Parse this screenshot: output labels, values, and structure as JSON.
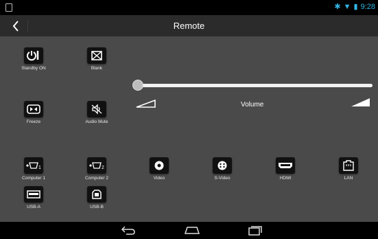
{
  "status": {
    "time": "9:28"
  },
  "header": {
    "title": "Remote"
  },
  "buttons": {
    "standby": "Standby ON",
    "blank": "Blank",
    "freeze": "Freeze",
    "audio_mute": "Audio Mute",
    "computer1": "Computer 1",
    "computer2": "Computer 2",
    "video": "Video",
    "svideo": "S-Video",
    "hdmi": "HDMI",
    "lan": "LAN",
    "usba": "USB-A",
    "usbb": "USB-B"
  },
  "volume": {
    "label": "Volume",
    "level": 0
  },
  "colors": {
    "background": "#4a4a4a",
    "titlebar": "#2b2b2b",
    "button": "#111111",
    "accent": "#33b5e5"
  },
  "icons": [
    "back-icon",
    "power-icon",
    "blank-icon",
    "freeze-icon",
    "mute-icon",
    "vga-icon",
    "video-icon",
    "svideo-icon",
    "hdmi-icon",
    "lan-icon",
    "usb-a-icon",
    "usb-b-icon",
    "nav-back-icon",
    "nav-home-icon",
    "nav-recent-icon"
  ]
}
